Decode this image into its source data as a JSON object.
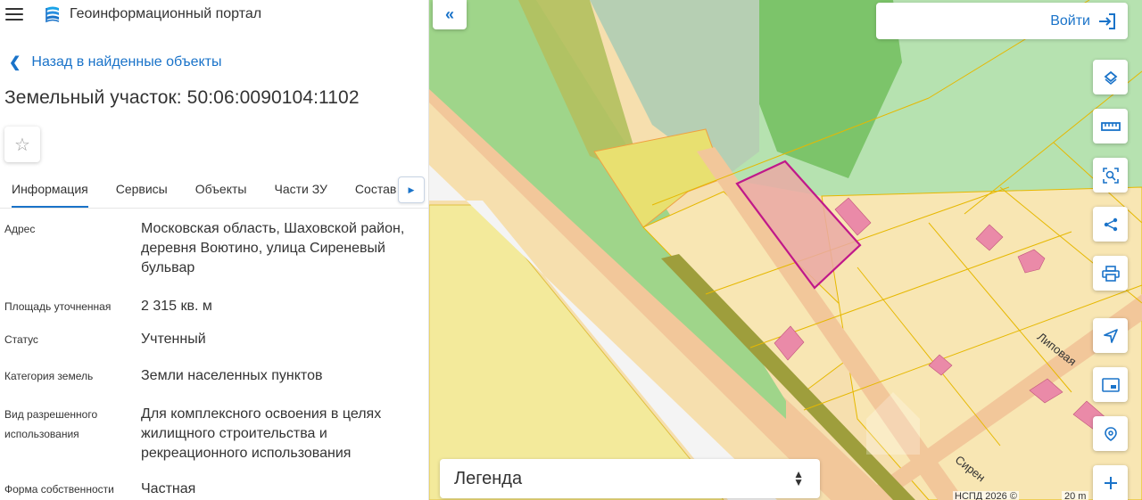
{
  "header": {
    "portal_title": "Геоинформационный портал"
  },
  "back_link": "Назад в найденные объекты",
  "parcel_title": "Земельный участок: 50:06:0090104:1102",
  "favorite_icon": "star-icon",
  "tabs": [
    {
      "label": "Информация",
      "active": true
    },
    {
      "label": "Сервисы",
      "active": false
    },
    {
      "label": "Объекты",
      "active": false
    },
    {
      "label": "Части ЗУ",
      "active": false
    },
    {
      "label": "Состав",
      "active": false
    }
  ],
  "info": {
    "address_label": "Адрес",
    "address_value": "Московская область, Шаховской район, деревня Воютино, улица Сиреневый бульвар",
    "area_label": "Площадь уточненная",
    "area_value": "2 315 кв. м",
    "status_label": "Статус",
    "status_value": "Учтенный",
    "category_label": "Категория земель",
    "category_value": "Земли населенных пунктов",
    "usage_label": "Вид разрешенного использования",
    "usage_value": "Для комплексного освоения в целях жилищного строительства и рекреационного использования",
    "ownership_label": "Форма собственности",
    "ownership_value": "Частная"
  },
  "map": {
    "login_label": "Войти",
    "legend_label": "Легенда",
    "attribution": "НСПД 2026 ©",
    "scale": "20 m",
    "street_lipovaya": "Липовая",
    "street_siren": "Сирен",
    "collapse_symbol": "«",
    "tools": [
      "layers-icon",
      "ruler-icon",
      "area-search-icon",
      "share-icon",
      "print-icon",
      "navigate-icon",
      "picture-in-picture-icon",
      "geo-search-icon",
      "zoom-in-icon"
    ]
  },
  "colors": {
    "accent": "#1a73c9",
    "selected_parcel": "#c0188a",
    "forest": "#8fcf7a",
    "road": "#f5c9a0"
  }
}
